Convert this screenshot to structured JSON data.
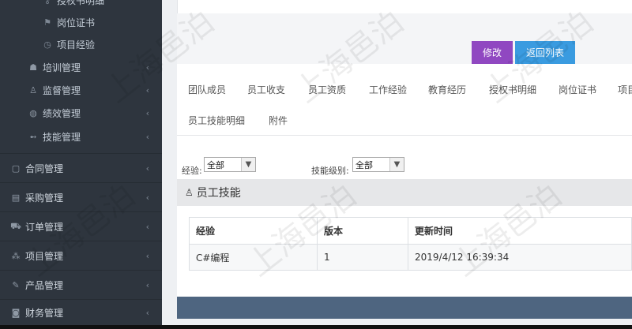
{
  "sidebar": {
    "sub_items": [
      {
        "icon": "key-icon",
        "glyph": "⚷",
        "label": "授权书明细"
      },
      {
        "icon": "flag-icon",
        "glyph": "⚑",
        "label": "岗位证书"
      },
      {
        "icon": "clock-icon",
        "glyph": "◷",
        "label": "项目经验"
      }
    ],
    "group_items": [
      {
        "icon": "graduation-icon",
        "glyph": "☗",
        "label": "培训管理"
      },
      {
        "icon": "user-icon",
        "glyph": "♙",
        "label": "监督管理"
      },
      {
        "icon": "globe-icon",
        "glyph": "◍",
        "label": "绩效管理"
      },
      {
        "icon": "tag-icon",
        "glyph": "➻",
        "label": "技能管理"
      }
    ],
    "top_items": [
      {
        "icon": "document-icon",
        "glyph": "▢",
        "label": "合同管理"
      },
      {
        "icon": "archive-icon",
        "glyph": "▤",
        "label": "采购管理"
      },
      {
        "icon": "cart-icon",
        "glyph": "⛟",
        "label": "订单管理"
      },
      {
        "icon": "cubes-icon",
        "glyph": "⁂",
        "label": "项目管理"
      },
      {
        "icon": "edit-icon",
        "glyph": "✎",
        "label": "产品管理"
      },
      {
        "icon": "money-icon",
        "glyph": "◙",
        "label": "财务管理"
      }
    ],
    "chevron": "‹"
  },
  "toolbar": {
    "edit_label": "修改",
    "back_label": "返回列表",
    "edit_color": "#9048c1",
    "back_color": "#3a9be0"
  },
  "tabs": {
    "row1": [
      "团队成员",
      "员工收支",
      "员工资质",
      "工作经验",
      "教育经历",
      "授权书明细",
      "岗位证书",
      "项目"
    ],
    "row2": [
      "员工技能明细",
      "附件"
    ]
  },
  "filters": {
    "experience_label": "经验:",
    "experience_value": "全部",
    "skill_level_label": "技能级别:",
    "skill_level_value": "全部"
  },
  "section": {
    "title": "员工技能"
  },
  "table": {
    "headers": [
      "经验",
      "版本",
      "更新时间"
    ],
    "rows": [
      [
        "C#编程",
        "1",
        "2019/4/12 16:39:34"
      ]
    ]
  },
  "watermark": "上海邑泊"
}
